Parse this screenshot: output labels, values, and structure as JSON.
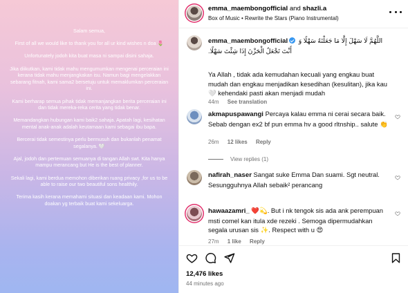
{
  "post_image": {
    "paragraphs": [
      "Salam semua,",
      "First of all we would like to thank you for all ur kind wishes n doa 🌷",
      "Unfortunately jodoh kita buat masa ni sampai disini sahaja.",
      "Jika diikutkan, kami tidak mahu mengumumkan mengenai perceraian ini kerana tidak mahu menjangkakan isu. Namun bagi mengelakkan sebarang fitnah, kami sama2 bersetuju untuk memaklumkan perceraian ini.",
      "Kami berharap semua pihak tidak memanjangkan berita perceraian ini dan tidak mereka-reka cerita yang tidak benar.",
      "Memandangkan hubungan kami baik2 sahaja. Apatah lagi, kesihatan mental anak-anak adalah keutamaan kami sebagai ibu bapa.",
      "Bercerai tidak semestinya perlu bermusuh dan bukanlah penamat segalanya. 🤍",
      "Ajal, jodoh dan pertemuan semuanya di tangan Allah swt. Kita hanya mampu merancang but He is the best of planner.",
      "Sekali lagi, kami berdua memohon diberikan ruang privacy ,for us to be able to raise our two beautiful sons healthily.",
      "Terima kasih kerana memahami situasi dan keadaan kami. Mohon doakan yg terbaik buat kami sekeluarga."
    ]
  },
  "header": {
    "user1": "emma_maembongofficial",
    "and": " and ",
    "user2": "shazli.a",
    "music": "Box of Music • Rewrite the Stars (Piano Instrumental)"
  },
  "caption": {
    "username": "emma_maembongofficial",
    "arabic": "اللَّهُمَّ لَا سَهْلَ إِلَّا مَا جَعَلْتَهُ سَهْلًا وَ أَنْتَ تَجْعَلُ الْحَزْنَ إِذَا شِئْتَ سَهْلًا.",
    "text": "Ya Allah , tidak ada kemudahan kecuali yang engkau buat mudah dan engkau menjadikan kesedihan (kesulitan), jika kau 🤍 kehendaki pasti akan menjadi mudah",
    "age": "44m",
    "see_translation": "See translation"
  },
  "comments": [
    {
      "username": "akmapuspawangi",
      "text": "Percaya kalau emma ni cerai secara baik. Sebab dengan ex2 bf pun emma hv a good rltnship.. salute 👏",
      "age": "26m",
      "likes": "12 likes",
      "reply": "Reply",
      "view_replies": "View replies (1)"
    },
    {
      "username": "nafirah_naser",
      "text": "Sangat suke Emma Dan suami. Sgt neutral. Sesungguhnya Allah sebaik² perancang"
    },
    {
      "username": "hawaazamri_",
      "text": "❤️💫. But i nk tengok sis ada ank perempuan msti comel kan itula xde rezeki . Semoga dipermudahkan segala urusan sis ✨. Respect with u 😍",
      "age": "27m",
      "likes": "1 like",
      "reply": "Reply"
    }
  ],
  "footer": {
    "likes": "12,476 likes",
    "time": "44 minutes ago"
  },
  "icons": [
    "heart-icon",
    "comment-icon",
    "share-icon",
    "bookmark-icon",
    "more-options-icon",
    "verified-badge-icon"
  ]
}
